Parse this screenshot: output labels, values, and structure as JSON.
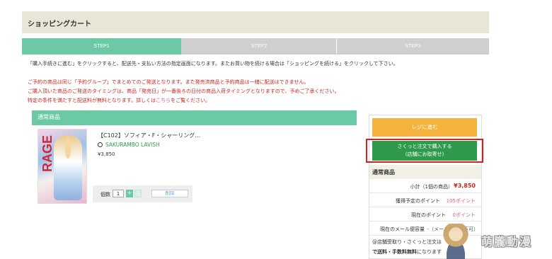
{
  "page": {
    "title": "ショッピングカート"
  },
  "steps": [
    {
      "label": "STEP1",
      "active": true
    },
    {
      "label": "STEP2",
      "active": false
    },
    {
      "label": "STEP3",
      "active": false
    }
  ],
  "colors": {
    "accent": "#6cc9a6",
    "warning": "#c8281e",
    "register": "#f3b33c",
    "quick": "#2f9a4c",
    "highlight": "#d32020"
  },
  "info_text": "「購入手続きに進む」をクリックすると、配送先・支払い方法の指定画面になります。またお買い物を続ける場合は「ショッピングを続ける」をクリックして下さい。",
  "warnings": {
    "line1": "ご予約の商品は同じ「予約グループ」でまとめてのご発送となります。また発売済商品と予約商品は一緒に配送はできません。",
    "line2": "ご購入頂いた商品のご発送のタイミングは、商品「発売日」が一番後ろの日付の商品入荷タイミングとなりますので、予めご了承ください。",
    "line3_pre": "特定の条件を満たすと配送料が無料となります。詳しくは",
    "line3_link": "こちら",
    "line3_post": "をご覧ください。"
  },
  "cart": {
    "category": "通常商品",
    "item": {
      "name": "【C102】ソフィア・F・シャーリング…",
      "brand": "SAKURAMBO LAVISH",
      "price": "¥3,850",
      "thumb_text": "RAGE",
      "qty_label": "個数",
      "qty": "1",
      "plus": "+",
      "minus": "-",
      "delete": "削除"
    }
  },
  "sidebar": {
    "register_button": "レジに進む",
    "quick_button_line1": "さくっと注文で購入する",
    "quick_button_line2": "(店舗にお取寄せ)",
    "summary_title": "通常商品",
    "subtotal_label": "小計（1個の商品）",
    "subtotal_value": "¥3,850",
    "points_label": "獲得予定のポイント",
    "points_value": "105ポイント",
    "current_points_label": "現在のポイント",
    "current_points_value": "0ポイント",
    "mail_label": "現在のメール便容量",
    "mail_value": "-（メール便利用不可）",
    "note_line1": "@店舗受取り・さくっと注文は",
    "note_line2_bold": "で送料・手数料無料",
    "note_line2_rest": "になります"
  },
  "watermark": {
    "text": "萌朧動漫"
  }
}
